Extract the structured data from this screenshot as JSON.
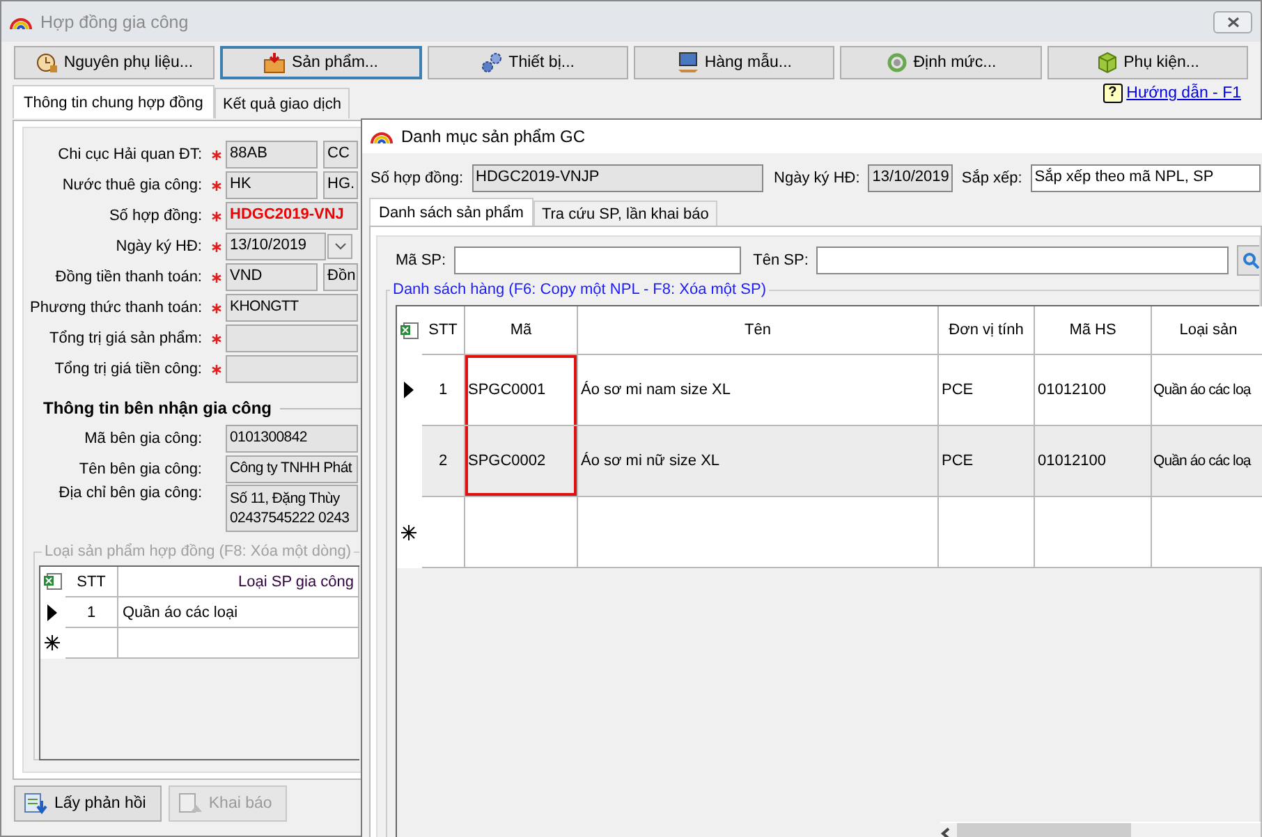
{
  "window": {
    "title": "Hợp đồng gia công"
  },
  "toolbar": [
    {
      "label": "Nguyên phụ liệu...",
      "selected": false
    },
    {
      "label": "Sản phẩm...",
      "selected": true
    },
    {
      "label": "Thiết bị...",
      "selected": false
    },
    {
      "label": "Hàng mẫu...",
      "selected": false
    },
    {
      "label": "Định mức...",
      "selected": false
    },
    {
      "label": "Phụ kiện...",
      "selected": false
    }
  ],
  "help_icon": "?",
  "help_link": "Hướng dẫn - F1",
  "tabs": [
    {
      "label": "Thông tin chung hợp đồng",
      "selected": true
    },
    {
      "label": "Kết quả giao dịch",
      "selected": false
    }
  ],
  "contract_fields": [
    {
      "kind": "pair",
      "label": "Chi cục Hải quan ĐT:",
      "required": true,
      "value": "88AB",
      "extra": "CC"
    },
    {
      "kind": "pair",
      "label": "Nước thuê gia công:",
      "required": true,
      "value": "HK",
      "extra": "HG."
    },
    {
      "kind": "emphasis",
      "label": "Số hợp đồng:",
      "required": true,
      "value": "HDGC2019-VNJ"
    },
    {
      "kind": "date",
      "label": "Ngày ký HĐ:",
      "required": true,
      "value": "13/10/2019"
    },
    {
      "kind": "pair",
      "label": "Đồng tiền thanh toán:",
      "required": true,
      "value": "VND",
      "extra": "Đồn"
    },
    {
      "kind": "text",
      "label": "Phương thức thanh toán:",
      "required": true,
      "value": "KHONGTT"
    },
    {
      "kind": "text",
      "label": "Tổng trị giá sản phẩm:",
      "required": true
    },
    {
      "kind": "text",
      "label": "Tổng trị giá tiền công:",
      "required": true
    }
  ],
  "receiver": {
    "heading": "Thông tin bên nhận gia công",
    "fields": [
      {
        "kind": "text",
        "label": "Mã bên gia công:",
        "required": false,
        "value": "0101300842"
      },
      {
        "kind": "text",
        "label": "Tên bên gia công:",
        "required": false,
        "value": "Công ty TNHH Phát"
      },
      {
        "kind": "multiline",
        "label": "Địa chỉ bên gia công:",
        "required": false,
        "lines": [
          "Số 11, Đặng Thùy",
          "02437545222 0243"
        ]
      }
    ]
  },
  "product_types": {
    "title": "Loại sản phẩm hợp đồng (F8: Xóa một dòng)",
    "columns": [
      "STT",
      "Loại SP gia công"
    ],
    "rows": [
      {
        "cells": [
          "1",
          "Quần áo các loại"
        ],
        "current": true
      }
    ]
  },
  "buttons": [
    {
      "label": "Lấy phản hồi",
      "disabled": false
    },
    {
      "label": "Khai báo",
      "disabled": true
    }
  ],
  "dialog": {
    "title": "Danh mục sản phẩm GC",
    "contract_label": "Số hợp đồng:",
    "contract_value": "HDGC2019-VNJP",
    "date_label": "Ngày ký HĐ:",
    "date_value": "13/10/2019",
    "sort_label": "Sắp xếp:",
    "sort_value": "Sắp xếp theo mã NPL, SP",
    "tabs": [
      {
        "label": "Danh sách sản phẩm",
        "selected": true
      },
      {
        "label": "Tra cứu SP, lần khai báo",
        "selected": false
      }
    ],
    "search_fields": [
      {
        "label": "Mã SP:"
      },
      {
        "label": "Tên SP:"
      }
    ],
    "group_title": "Danh sách hàng (F6: Copy một NPL - F8: Xóa một SP)",
    "table": {
      "columns": [
        {
          "label": "STT",
          "highlighted": false
        },
        {
          "label": "Mã",
          "highlighted": true
        },
        {
          "label": "Tên",
          "highlighted": false
        },
        {
          "label": "Đơn vị tính",
          "highlighted": false
        },
        {
          "label": "Mã HS",
          "highlighted": false
        },
        {
          "label": "Loại sản",
          "highlighted": false
        }
      ],
      "rows": [
        {
          "cells": [
            "1",
            "SPGC0001",
            "Áo sơ mi nam size XL",
            "PCE",
            "01012100",
            "Quần áo các loạ"
          ],
          "current": true,
          "shaded": false
        },
        {
          "cells": [
            "2",
            "SPGC0002",
            "Áo sơ mi nữ size XL",
            "PCE",
            "01012100",
            "Quần áo các loạ"
          ],
          "current": false,
          "shaded": true
        }
      ]
    }
  }
}
